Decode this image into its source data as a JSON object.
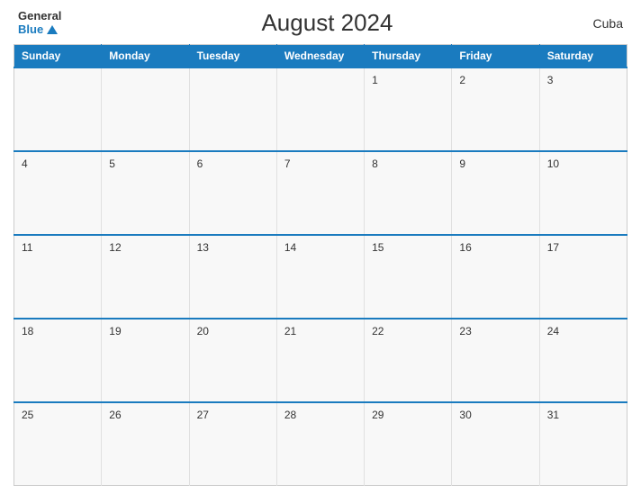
{
  "header": {
    "logo_general": "General",
    "logo_blue": "Blue",
    "title": "August 2024",
    "country": "Cuba"
  },
  "calendar": {
    "days_of_week": [
      "Sunday",
      "Monday",
      "Tuesday",
      "Wednesday",
      "Thursday",
      "Friday",
      "Saturday"
    ],
    "weeks": [
      [
        "",
        "",
        "",
        "",
        "1",
        "2",
        "3"
      ],
      [
        "4",
        "5",
        "6",
        "7",
        "8",
        "9",
        "10"
      ],
      [
        "11",
        "12",
        "13",
        "14",
        "15",
        "16",
        "17"
      ],
      [
        "18",
        "19",
        "20",
        "21",
        "22",
        "23",
        "24"
      ],
      [
        "25",
        "26",
        "27",
        "28",
        "29",
        "30",
        "31"
      ]
    ]
  }
}
